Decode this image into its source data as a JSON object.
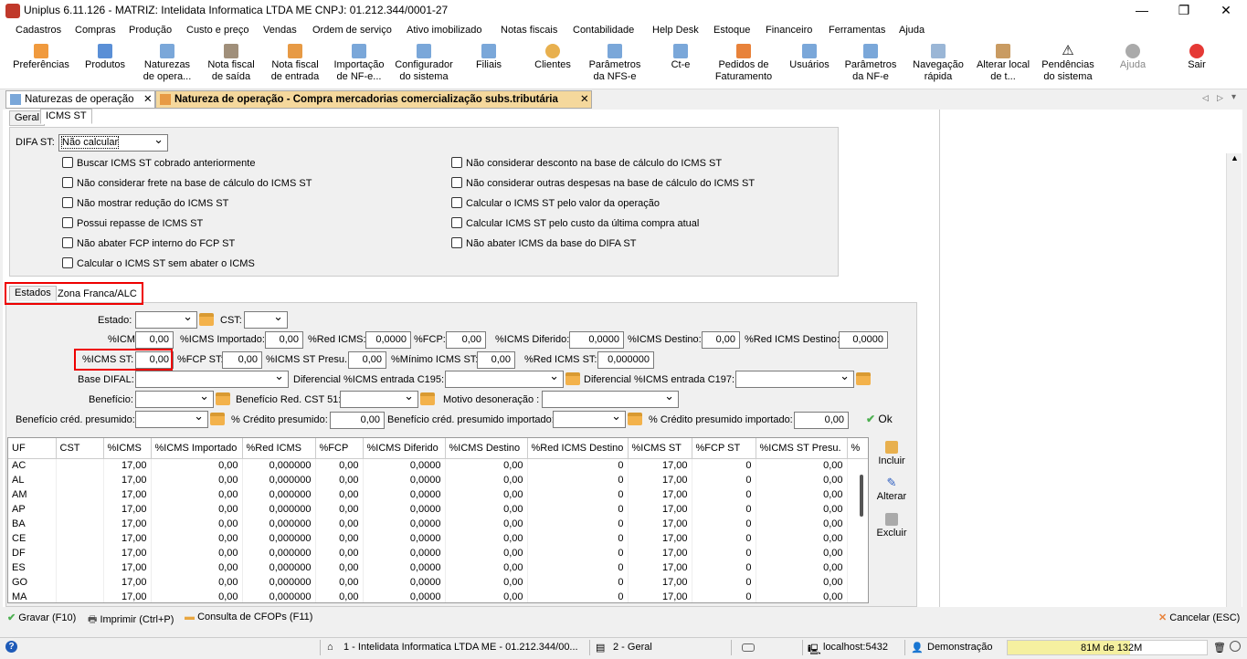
{
  "window": {
    "title": "Uniplus 6.11.126 - MATRIZ: Intelidata Informatica LTDA ME CNPJ: 01.212.344/0001-27"
  },
  "menu": [
    "Cadastros",
    "Compras",
    "Produção",
    "Custo e preço",
    "Vendas",
    "Ordem de serviço",
    "Ativo imobilizado",
    "Notas fiscais",
    "Contabilidade",
    "Help Desk",
    "Estoque",
    "Financeiro",
    "Ferramentas",
    "Ajuda"
  ],
  "toolbar": [
    {
      "l1": "Preferências",
      "l2": "",
      "icon": "preferences-icon"
    },
    {
      "l1": "Produtos",
      "l2": "",
      "icon": "products-icon"
    },
    {
      "l1": "Naturezas",
      "l2": "de opera...",
      "icon": "naturezas-icon"
    },
    {
      "l1": "Nota fiscal",
      "l2": "de saída",
      "icon": "nota-saida-icon"
    },
    {
      "l1": "Nota fiscal",
      "l2": "de entrada",
      "icon": "nota-entrada-icon"
    },
    {
      "l1": "Importação",
      "l2": "de NF-e...",
      "icon": "import-nfe-icon"
    },
    {
      "l1": "Configurador",
      "l2": "do sistema",
      "icon": "config-icon"
    },
    {
      "l1": "Filiais",
      "l2": "",
      "icon": "filiais-icon"
    },
    {
      "l1": "Clientes",
      "l2": "",
      "icon": "clientes-icon"
    },
    {
      "l1": "Parâmetros",
      "l2": "da NFS-e",
      "icon": "param-nfse-icon"
    },
    {
      "l1": "Ct-e",
      "l2": "",
      "icon": "cte-icon"
    },
    {
      "l1": "Pedidos de",
      "l2": "Faturamento",
      "icon": "pedidos-icon"
    },
    {
      "l1": "Usuários",
      "l2": "",
      "icon": "usuarios-icon"
    },
    {
      "l1": "Parâmetros",
      "l2": "da NF-e",
      "icon": "param-nfe-icon"
    },
    {
      "l1": "Navegação",
      "l2": "rápida",
      "icon": "navegacao-icon"
    },
    {
      "l1": "Alterar local",
      "l2": "de t...",
      "icon": "home-icon"
    },
    {
      "l1": "Pendências",
      "l2": "do sistema",
      "icon": "warning-icon"
    },
    {
      "l1": "Ajuda",
      "l2": "",
      "icon": "help-icon"
    },
    {
      "l1": "Sair",
      "l2": "",
      "icon": "power-icon"
    }
  ],
  "tabs": [
    "Naturezas de operação",
    "Natureza de operação - Compra mercadorias comercialização subs.tributária"
  ],
  "subtabs": [
    "Geral",
    "ICMS ST"
  ],
  "difa": {
    "label": "DIFA ST:",
    "value": "Não calcular"
  },
  "checks_left": [
    "Buscar ICMS ST cobrado anteriormente",
    "Não considerar frete na base de cálculo do ICMS ST",
    "Não mostrar redução do ICMS ST",
    "Possui repasse de ICMS ST",
    "Não abater FCP interno do FCP ST",
    "Calcular o ICMS ST sem abater o ICMS"
  ],
  "checks_right": [
    "Não considerar desconto na base de cálculo do ICMS ST",
    "Não considerar outras despesas na base de cálculo do ICMS ST",
    "Calcular o ICMS ST pelo valor da operação",
    "Calcular ICMS ST pelo custo da última compra atual",
    "Não abater ICMS da base do DIFA ST"
  ],
  "statetabs": [
    "Estados",
    "Zona Franca/ALC"
  ],
  "form": {
    "estado": "Estado:",
    "cst": "CST:",
    "icms": "%ICMS:",
    "icms_v": "0,00",
    "icms_imp": "%ICMS Importado:",
    "icms_imp_v": "0,00",
    "red_icms": "%Red ICMS:",
    "red_icms_v": "0,0000",
    "fcp": "%FCP:",
    "fcp_v": "0,00",
    "icms_dif": "%ICMS Diferido:",
    "icms_dif_v": "0,0000",
    "icms_dest": "%ICMS Destino:",
    "icms_dest_v": "0,00",
    "red_dest": "%Red ICMS Destino:",
    "red_dest_v": "0,0000",
    "icms_st": "%ICMS ST:",
    "icms_st_v": "0,00",
    "fcp_st": "%FCP ST:",
    "fcp_st_v": "0,00",
    "icms_st_presu": "%ICMS ST Presu.:",
    "icms_st_presu_v": "0,00",
    "min_icms_st": "%Mínimo ICMS ST:",
    "min_icms_st_v": "0,00",
    "red_icms_st": "%Red ICMS ST:",
    "red_icms_st_v": "0,000000",
    "base_difal": "Base DIFAL:",
    "dif_c195": "Diferencial %ICMS entrada C195:",
    "dif_c197": "Diferencial %ICMS entrada C197:",
    "beneficio": "Benefício:",
    "ben_red": "Benefício Red. CST 51:",
    "motivo": "Motivo desoneração :",
    "ben_cred": "Benefício créd. presumido:",
    "cred_pres": "% Crédito presumido:",
    "cred_pres_v": "0,00",
    "ben_cred_imp": "Benefício créd. presumido importado:",
    "cred_pres_imp": "% Crédito presumido importado:",
    "cred_pres_imp_v": "0,00",
    "ok": "Ok"
  },
  "grid": {
    "columns": [
      "UF",
      "CST",
      "%ICMS",
      "%ICMS Importado",
      "%Red ICMS",
      "%FCP",
      "%ICMS Diferido",
      "%ICMS Destino",
      "%Red ICMS Destino",
      "%ICMS ST",
      "%FCP ST",
      "%ICMS ST Presu.",
      "%"
    ],
    "rows": [
      [
        "AC",
        "",
        "17,00",
        "0,00",
        "0,000000",
        "0,00",
        "0,0000",
        "0,00",
        "0",
        "17,00",
        "0",
        "0,00",
        ""
      ],
      [
        "AL",
        "",
        "17,00",
        "0,00",
        "0,000000",
        "0,00",
        "0,0000",
        "0,00",
        "0",
        "17,00",
        "0",
        "0,00",
        ""
      ],
      [
        "AM",
        "",
        "17,00",
        "0,00",
        "0,000000",
        "0,00",
        "0,0000",
        "0,00",
        "0",
        "17,00",
        "0",
        "0,00",
        ""
      ],
      [
        "AP",
        "",
        "17,00",
        "0,00",
        "0,000000",
        "0,00",
        "0,0000",
        "0,00",
        "0",
        "17,00",
        "0",
        "0,00",
        ""
      ],
      [
        "BA",
        "",
        "17,00",
        "0,00",
        "0,000000",
        "0,00",
        "0,0000",
        "0,00",
        "0",
        "17,00",
        "0",
        "0,00",
        ""
      ],
      [
        "CE",
        "",
        "17,00",
        "0,00",
        "0,000000",
        "0,00",
        "0,0000",
        "0,00",
        "0",
        "17,00",
        "0",
        "0,00",
        ""
      ],
      [
        "DF",
        "",
        "17,00",
        "0,00",
        "0,000000",
        "0,00",
        "0,0000",
        "0,00",
        "0",
        "17,00",
        "0",
        "0,00",
        ""
      ],
      [
        "ES",
        "",
        "17,00",
        "0,00",
        "0,000000",
        "0,00",
        "0,0000",
        "0,00",
        "0",
        "17,00",
        "0",
        "0,00",
        ""
      ],
      [
        "GO",
        "",
        "17,00",
        "0,00",
        "0,000000",
        "0,00",
        "0,0000",
        "0,00",
        "0",
        "17,00",
        "0",
        "0,00",
        ""
      ],
      [
        "MA",
        "",
        "17,00",
        "0,00",
        "0,000000",
        "0,00",
        "0,0000",
        "0,00",
        "0",
        "17,00",
        "0",
        "0,00",
        ""
      ]
    ]
  },
  "side": [
    "Incluir",
    "Alterar",
    "Excluir"
  ],
  "bottom": {
    "gravar": "Gravar (F10)",
    "imprimir": "Imprimir (Ctrl+P)",
    "consulta": "Consulta de CFOPs (F11)",
    "cancelar": "Cancelar (ESC)"
  },
  "status": {
    "company": "1 - Intelidata Informatica LTDA ME - 01.212.344/00...",
    "geral": "2 - Geral",
    "host": "localhost:5432",
    "user": "Demonstração",
    "mem": "81M de 132M"
  },
  "colors": {
    "active_tab": "#f5d89c",
    "highlight": "#ff0000",
    "mem_bar": "#f5f0a0"
  }
}
